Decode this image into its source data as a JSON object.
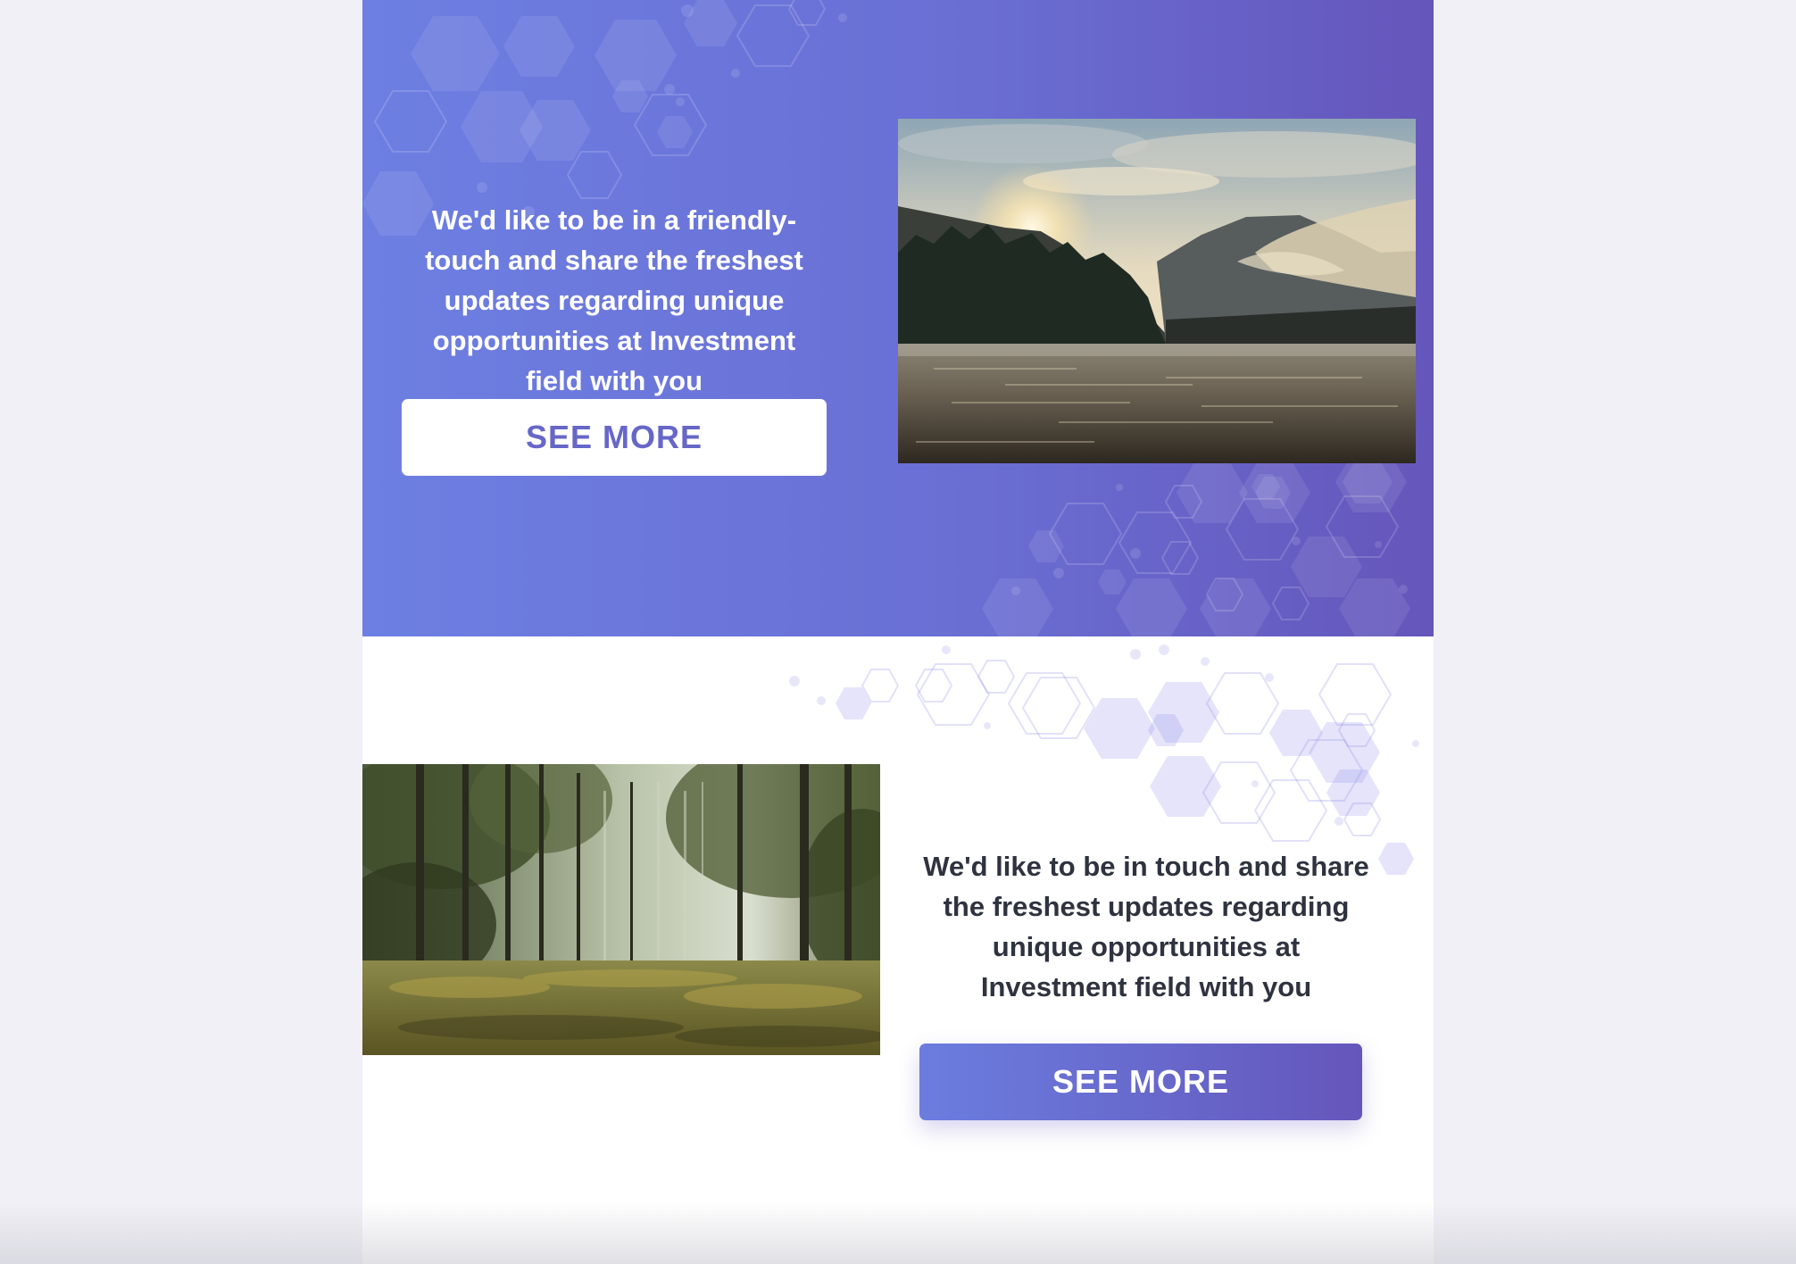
{
  "colors": {
    "page_background": "#f1f0f7",
    "hero_gradient_start": "#6d7fe2",
    "hero_gradient_end": "#6556bb",
    "button_text_purple": "#6667c8",
    "body_text": "#2f3340"
  },
  "hero": {
    "text": "We'd like to be in a friendly-touch and share the freshest updates regarding unique opportunities at Investment field with you",
    "button_label": "SEE MORE",
    "image_subject": "mountain lake at sunrise"
  },
  "section2": {
    "text": "We'd like to be in touch and share the freshest updates regarding unique opportunities at Investment field with you",
    "button_label": "SEE MORE",
    "image_subject": "sunlit forest"
  }
}
